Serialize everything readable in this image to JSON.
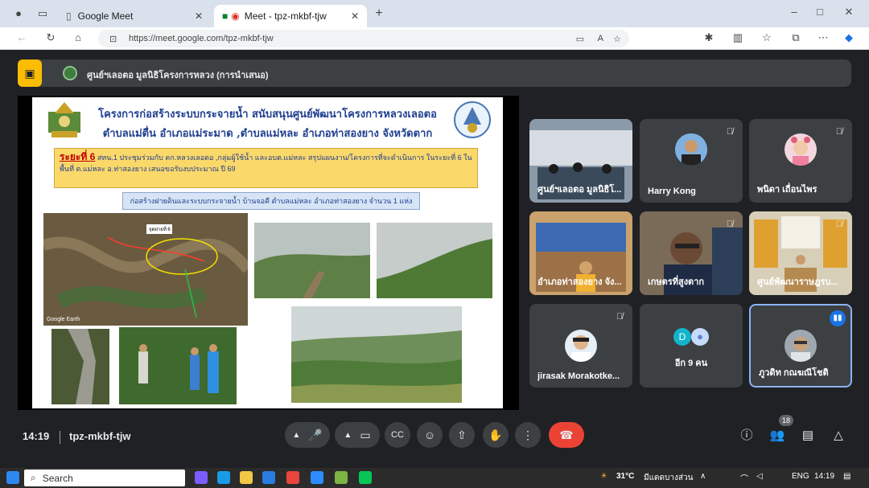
{
  "browser": {
    "tabs": [
      {
        "label": "Google Meet"
      },
      {
        "label": "Meet - tpz-mkbf-tjw"
      }
    ],
    "url": "https://meet.google.com/tpz-mkbf-tjw"
  },
  "meet": {
    "presenter": "ศูนย์ฯเลอตอ มูลนิธิโครงการหลวง (การนำเสนอ)",
    "slide": {
      "title_line1": "โครงการก่อสร้างระบบกระจายน้ำ สนับสนุนศูนย์พัฒนาโครงการหลวงเลอตอ",
      "title_line2": "ตำบลแม่ตื่น อำเภอแม่ระมาด ,ตำบลแม่หละ อำเภอท่าสองยาง จังหวัดตาก",
      "phase": "ระยะที่ 6",
      "phase_text": "สทน.1 ประชุมร่วมกับ คก.หลวงเลอตอ ,กลุ่มผู้ใช้น้ำ และอบต.แม่หละ สรุปแผนงาน/โครงการที่จะดำเนินการ ในระยะที่ 6 ในพื้นที่ ต.แม่หละ อ.ท่าสองยาง เสนอขอรับงบประมาณ ปี 69",
      "subtitle": "ก่อสร้างฝายดินและระบบกระจายน้ำ บ้านจอคี ตำบลแม่หละ อำเภอท่าสองยาง จำนวน 1 แห่ง",
      "map_label": "Google Earth",
      "map_tag": "จุดฝายที่ 6"
    },
    "participants": [
      {
        "name": "ศูนย์ฯเลอตอ มูลนิธิโ...",
        "muted": false,
        "kind": "video"
      },
      {
        "name": "Harry Kong",
        "muted": true,
        "kind": "avatar"
      },
      {
        "name": "พนิดา เถื่อนไพร",
        "muted": true,
        "kind": "avatar"
      },
      {
        "name": "อำเภอท่าสองยาง จัง...",
        "muted": false,
        "kind": "video"
      },
      {
        "name": "เกษตรที่สูงตาก",
        "muted": true,
        "kind": "video"
      },
      {
        "name": "ศูนย์พัฒนาราษฎรบ...",
        "muted": true,
        "kind": "video"
      },
      {
        "name": "jirasak Morakotke...",
        "muted": true,
        "kind": "avatar"
      },
      {
        "name": "อีก 9 คน",
        "muted": false,
        "kind": "others",
        "initial": "D"
      },
      {
        "name": "ภูวดิท กณฆณีโชติ",
        "muted": false,
        "kind": "avatar",
        "speaking": true
      }
    ],
    "bottom": {
      "time": "14:19",
      "meeting_code": "tpz-mkbf-tjw",
      "participant_count": "18"
    }
  },
  "taskbar": {
    "search": "Search",
    "weather": "31°C",
    "weather_text": "มีแดดบางส่วน",
    "lang": "ENG",
    "clock": "14:19"
  },
  "colors": {
    "meet_bg": "#202124",
    "tile_bg": "#3c4043",
    "end_call": "#ea4335",
    "speaking_border": "#8ab4f8",
    "info_icon": "#fbbc04"
  }
}
